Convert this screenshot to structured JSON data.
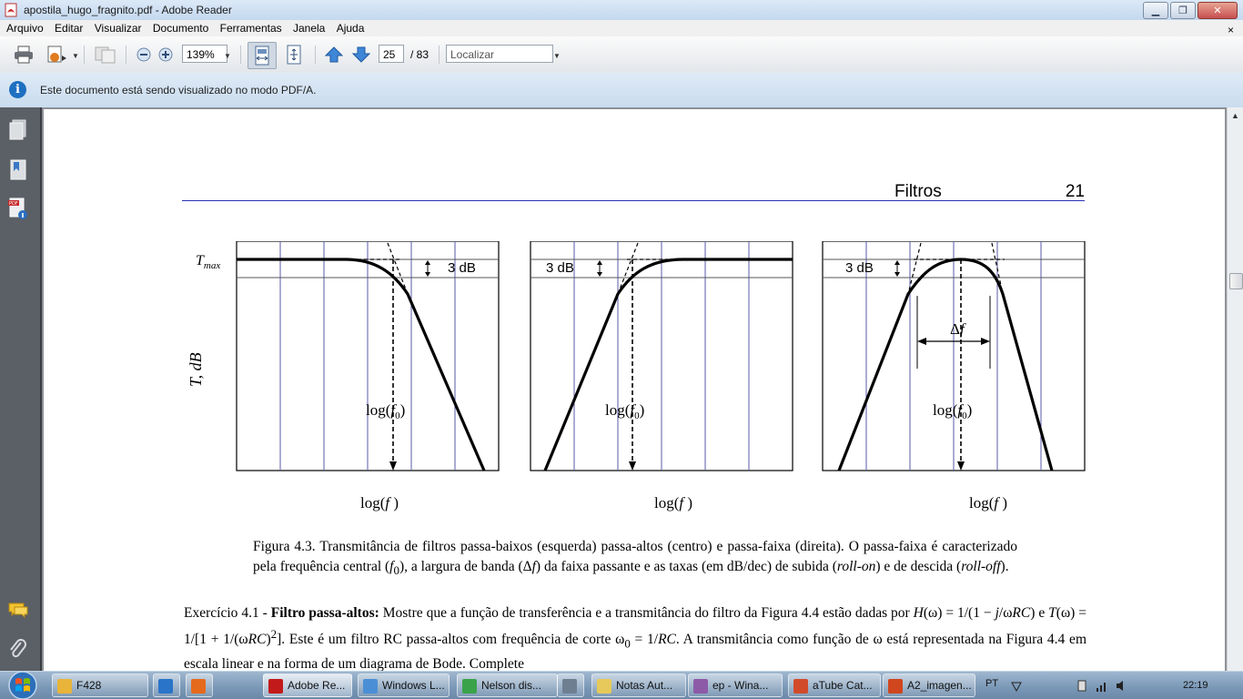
{
  "window": {
    "title": "apostila_hugo_fragnito.pdf - Adobe Reader",
    "controls": [
      "minimize",
      "maximize",
      "close"
    ]
  },
  "menu": {
    "items": [
      "Arquivo",
      "Editar",
      "Visualizar",
      "Documento",
      "Ferramentas",
      "Janela",
      "Ajuda"
    ],
    "close_glyph": "×"
  },
  "toolbar": {
    "zoom": "139%",
    "page_current": "25",
    "page_total": "/ 83",
    "find_placeholder": "Localizar"
  },
  "infobar": {
    "message": "Este documento está sendo visualizado no modo PDF/A."
  },
  "page": {
    "section": "Filtros",
    "number": "21"
  },
  "figure": {
    "tmax": "T",
    "tmax_sub": "max",
    "yaxis": "T, dB",
    "db3": "3 dB",
    "f0_prefix": "log(",
    "f0_var": "f",
    "f0_sub": "0",
    "f0_suffix": ")",
    "xaxis_prefix": "log(",
    "xaxis_var": "f",
    "xaxis_suffix": " )",
    "delta_f_sym": "Δ",
    "delta_f_var": "f"
  },
  "caption": {
    "p1": "Figura 4.3. Transmitância de filtros passa-baixos (esquerda) passa-altos (centro) e passa-faixa (direita). O passa-faixa é caracterizado pela frequência central (",
    "f0_var": "f",
    "f0_sub": "0",
    "p2": "), a largura de banda (Δ",
    "df_var": "f",
    "p3": ") da faixa passante e as taxas (em dB/dec) de subida (",
    "rollon": "roll-on",
    "p4": ") e de descida (",
    "rolloff": "roll-off",
    "p5": ")."
  },
  "exercise": {
    "prefix": "Exercício 4.1 - ",
    "title": "Filtro passa-altos:",
    "t1": " Mostre que a função de transferência e a transmitância do filtro da Figura 4.4 estão dadas por ",
    "H": "H",
    "t2": "(ω) = 1/(1 − ",
    "j": "j",
    "t3": "/ω",
    "RC1": "RC",
    "t4": ") e ",
    "T": "T",
    "t5": "(ω) = 1/[1 + 1/(ω",
    "RC2": "RC",
    "t6": ")",
    "sup2": "2",
    "t7": "]. Este é um filtro RC passa-altos com frequência de corte ω",
    "sub0": "0",
    "t8": " = 1/",
    "RC3": "RC",
    "t9": ". A transmitância como função de ω está representada na Figura 4.4 em escala linear e na forma de um diagrama de Bode. Complete"
  },
  "taskbar": {
    "tasks": [
      {
        "label": "F428",
        "color": "#e8b43a"
      },
      {
        "label": "",
        "color": "#2a74c9"
      },
      {
        "label": "",
        "color": "#e56a1c"
      },
      {
        "label": "Adobe Re...",
        "color": "#c21a1a"
      },
      {
        "label": "Windows L...",
        "color": "#4a8fd6"
      },
      {
        "label": "Nelson dis...",
        "color": "#3aa34a"
      },
      {
        "label": "",
        "color": "#6f7f92"
      },
      {
        "label": "Notas Aut...",
        "color": "#e6c95a"
      },
      {
        "label": "ep - Wina...",
        "color": "#8d5aa8"
      },
      {
        "label": "aTube Cat...",
        "color": "#d14b2b"
      },
      {
        "label": "A2_imagen...",
        "color": "#d0461e"
      }
    ],
    "lang": "PT",
    "clock": "22:19"
  },
  "colors": {
    "runhead_rule": "#2a31b8",
    "grid_lines": "#5a5aa8",
    "curve": "#000000"
  }
}
